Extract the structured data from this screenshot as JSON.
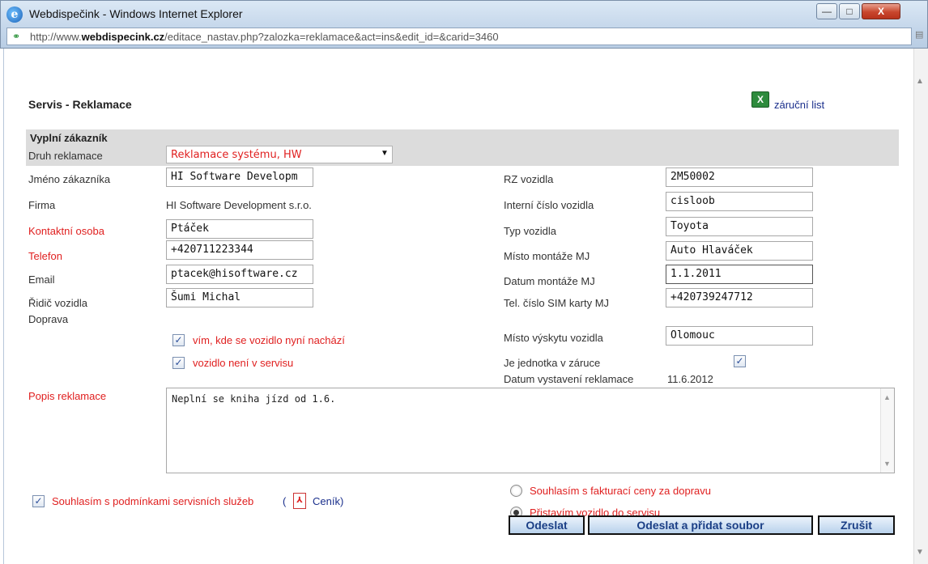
{
  "window": {
    "title": "Webdispečink - Windows Internet Explorer",
    "url_prefix": "http://www.",
    "url_domain": "webdispecink.cz",
    "url_rest": "/editace_nastav.php?zalozka=reklamace&act=ins&edit_id=&carid=3460",
    "minimize_symbol": "—",
    "maximize_symbol": "□",
    "close_symbol": "X"
  },
  "page": {
    "title": "Servis - Reklamace",
    "warranty_link": "záruční list",
    "section_title": "Vyplní zákazník"
  },
  "left": {
    "druh_label": "Druh reklamace",
    "druh_value": "Reklamace systému, HW",
    "jmeno_label": "Jméno zákazníka",
    "jmeno_value": "HI Software Developm",
    "firma_label": "Firma",
    "firma_value": "HI Software Development s.r.o.",
    "kontakt_label": "Kontaktní osoba",
    "kontakt_value": "Ptáček",
    "telefon_label": "Telefon",
    "telefon_value": "+420711223344",
    "email_label": "Email",
    "email_value": "ptacek@hisoftware.cz",
    "ridic_label": "Řidič vozidla",
    "ridic_value": "Šumi Michal",
    "doprava_label": "Doprava",
    "chk_vim_label": "vím, kde se vozidlo nyní nachází",
    "chk_neni_label": "vozidlo není v servisu",
    "popis_label": "Popis reklamace",
    "popis_value": "Neplní se kniha jízd od 1.6."
  },
  "right": {
    "rz_label": "RZ vozidla",
    "rz_value": "2M50002",
    "interni_label": "Interní číslo vozidla",
    "interni_value": "cisloob",
    "typ_label": "Typ vozidla",
    "typ_value": "Toyota",
    "misto_label": "Místo montáže MJ",
    "misto_value": "Auto Hlaváček",
    "datum_label": "Datum montáže MJ",
    "datum_value": "1.1.2011",
    "tel_label": "Tel. číslo SIM karty MJ",
    "tel_value": "+420739247712",
    "vyskyt_label": "Místo výskytu vozidla",
    "vyskyt_value": "Olomouc",
    "zaruka_label": "Je jednotka v záruce",
    "datum_vyst_label": "Datum vystavení reklamace",
    "datum_vyst_value": "11.6.2012"
  },
  "footer": {
    "souhlas_label": "Souhlasím s podmínkami servisních služeb",
    "paren_open": "(",
    "cenik_label": "Ceník)",
    "radio_fakturace": "Souhlasím s fakturací ceny za dopravu",
    "radio_pristavim": "Přistavím vozidlo do servisu",
    "btn_odeslat": "Odeslat",
    "btn_odeslat_pridat": "Odeslat a přidat soubor",
    "btn_zrusit": "Zrušit"
  },
  "checkmark": "✓",
  "colors": {
    "required_label": "#e02020",
    "button_text": "#1b3f86",
    "section_bar": "#dcdcdc"
  }
}
